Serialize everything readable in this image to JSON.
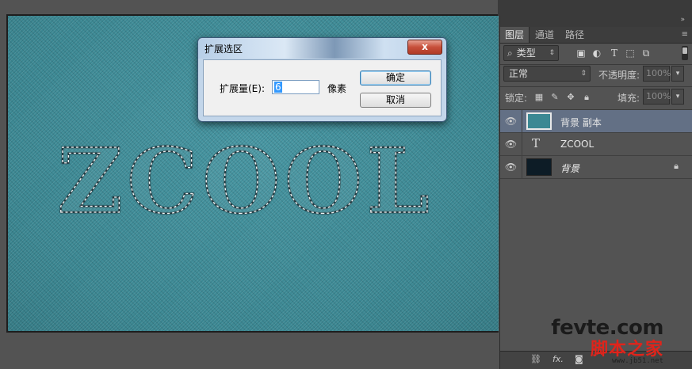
{
  "canvas": {
    "text": "ZCOOL",
    "background_color": "#3d8a95"
  },
  "dialog": {
    "title": "扩展选区",
    "close_label": "x",
    "expand_label": "扩展量(E):",
    "expand_value": "6",
    "unit_label": "像素",
    "ok_label": "确定",
    "cancel_label": "取消"
  },
  "panel": {
    "collapse_icon": "»",
    "tabs": [
      {
        "label": "图层",
        "active": true
      },
      {
        "label": "通道",
        "active": false
      },
      {
        "label": "路径",
        "active": false
      }
    ],
    "menu_icon": "≡",
    "filter": {
      "kind_label": "类型",
      "icons": [
        "image-filter-icon",
        "adjustment-filter-icon",
        "type-filter-icon",
        "shape-filter-icon",
        "smart-object-filter-icon"
      ]
    },
    "blend_mode": "正常",
    "opacity_label": "不透明度:",
    "opacity_value": "100%",
    "lock_label": "锁定:",
    "fill_label": "填充:",
    "fill_value": "100%",
    "layers": [
      {
        "name": "背景 副本",
        "type": "pixel",
        "selected": true,
        "visible": true
      },
      {
        "name": "ZCOOL",
        "type": "text",
        "selected": false,
        "visible": true
      },
      {
        "name": "背景",
        "type": "background",
        "selected": false,
        "visible": true,
        "locked": true
      }
    ],
    "bottom_icons": [
      "link-layers-icon",
      "fx-icon",
      "add-mask-icon"
    ],
    "fx_label": "fx."
  },
  "watermark": {
    "line1": "fevte.com",
    "line2": "脚本之家",
    "line3": "www.jb51.net"
  }
}
